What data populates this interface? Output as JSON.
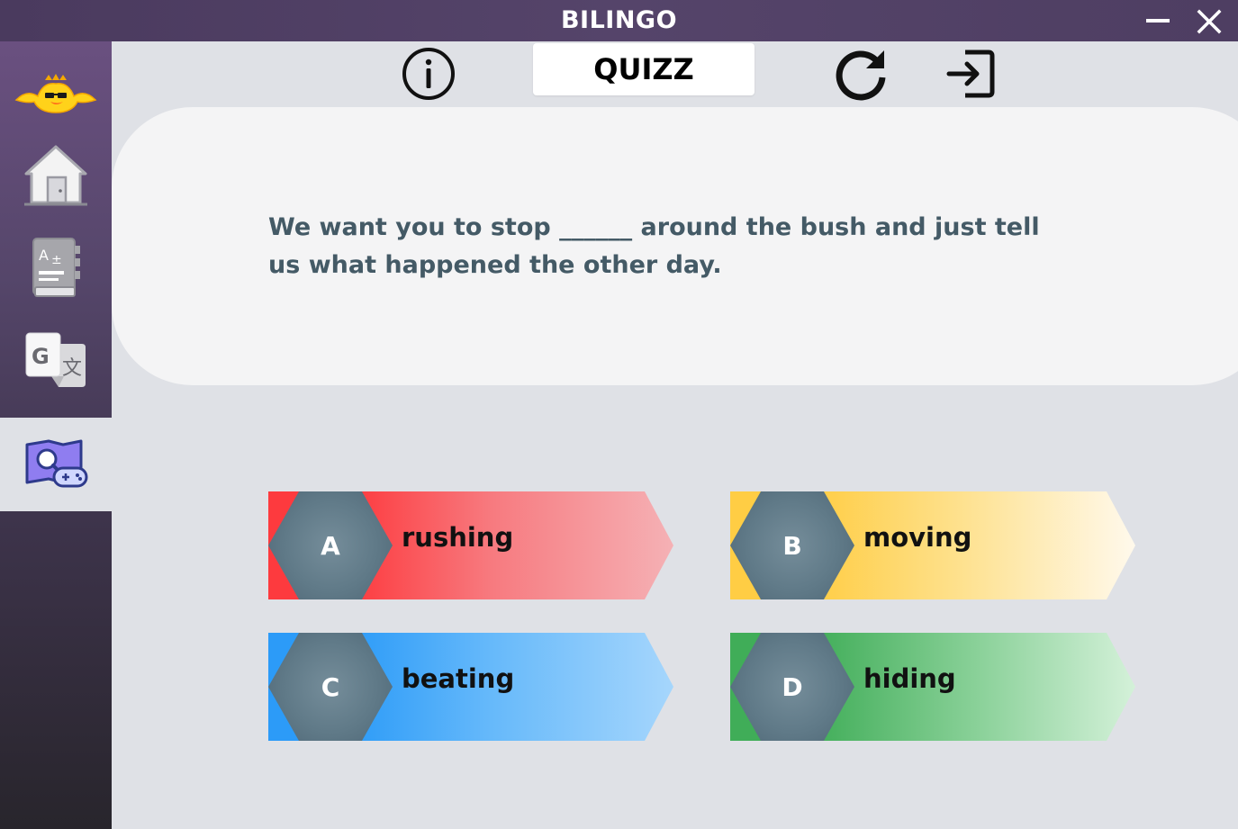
{
  "window": {
    "title": "BILINGO"
  },
  "toolbar": {
    "screen_title": "QUIZZ",
    "info_icon": "info-circle-icon",
    "refresh_icon": "refresh-icon",
    "exit_icon": "sign-out-icon"
  },
  "sidebar": {
    "items": [
      {
        "id": "logo",
        "icon": "duck-logo-icon"
      },
      {
        "id": "home",
        "icon": "home-icon"
      },
      {
        "id": "dictionary",
        "icon": "dictionary-book-icon"
      },
      {
        "id": "translate",
        "icon": "google-translate-icon"
      },
      {
        "id": "quiz-game",
        "icon": "quiz-game-icon",
        "active": true
      }
    ]
  },
  "question": {
    "text_before": "We want you to stop",
    "blank": "______",
    "text_after": "around the bush and just tell us what happened the other day."
  },
  "answers": [
    {
      "letter": "A",
      "text": "rushing",
      "color": "#fd3a3e"
    },
    {
      "letter": "B",
      "text": "moving",
      "color": "#ffcd44"
    },
    {
      "letter": "C",
      "text": "beating",
      "color": "#2c9bf8"
    },
    {
      "letter": "D",
      "text": "hiding",
      "color": "#40ad58"
    }
  ],
  "colors": {
    "titlebar": "#4a3a5e",
    "background": "#dfe1e6",
    "question_text": "#445a66",
    "hex_badge": "#607a88"
  }
}
